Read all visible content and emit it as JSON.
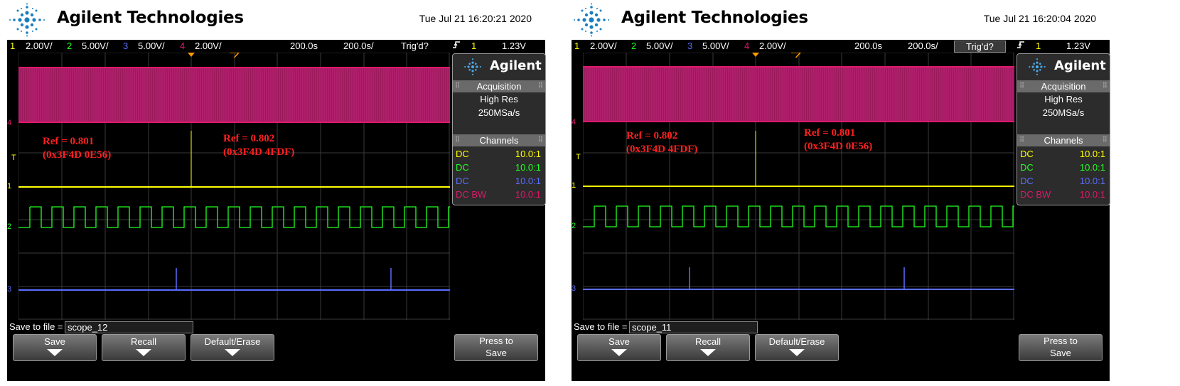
{
  "panels": [
    {
      "brand": "Agilent Technologies",
      "datetime": "Tue Jul 21 16:20:21 2020",
      "status": {
        "ch1_num": "1",
        "ch1_scale": "2.00V/",
        "ch2_num": "2",
        "ch2_scale": "5.00V/",
        "ch3_num": "3",
        "ch3_scale": "5.00V/",
        "ch4_num": "4",
        "ch4_scale": "2.00V/",
        "delay": "200.0s",
        "timebase": "200.0s/",
        "trig_state": "Trig'd?",
        "trig_slope_icon": "rising-edge-icon",
        "trig_source": "1",
        "trig_level": "1.23V"
      },
      "side": {
        "logo": "Agilent",
        "acq_title": "Acquisition",
        "acq_mode": "High Res",
        "acq_rate": "250MSa/s",
        "channels_title": "Channels",
        "channels": [
          {
            "coupling": "DC",
            "probe": "10.0:1",
            "color": "#ffff00"
          },
          {
            "coupling": "DC",
            "probe": "10.0:1",
            "color": "#22ff22"
          },
          {
            "coupling": "DC",
            "probe": "10.0:1",
            "color": "#5a6cff"
          },
          {
            "coupling": "DC BW",
            "probe": "10.0:1",
            "color": "#e0186c"
          }
        ]
      },
      "annotations": [
        {
          "line1": "Ref = 0.801",
          "line2": "(0x3F4D 0E56)"
        },
        {
          "line1": "Ref = 0.802",
          "line2": "(0x3F4D 4FDF)"
        }
      ],
      "save_label": "Save to file =",
      "save_file": "scope_12",
      "softkeys": [
        "Save",
        "Recall",
        "Default/Erase"
      ],
      "press_line1": "Press to",
      "press_line2": "Save",
      "ch_markers": {
        "t": "T",
        "c1": "1",
        "c2": "2",
        "c3": "3",
        "c4": "4"
      }
    },
    {
      "brand": "Agilent Technologies",
      "datetime": "Tue Jul 21 16:20:04 2020",
      "status": {
        "ch1_num": "1",
        "ch1_scale": "2.00V/",
        "ch2_num": "2",
        "ch2_scale": "5.00V/",
        "ch3_num": "3",
        "ch3_scale": "5.00V/",
        "ch4_num": "4",
        "ch4_scale": "2.00V/",
        "delay": "200.0s",
        "timebase": "200.0s/",
        "trig_state": "Trig'd?",
        "trig_slope_icon": "rising-edge-icon",
        "trig_source": "1",
        "trig_level": "1.23V"
      },
      "side": {
        "logo": "Agilent",
        "acq_title": "Acquisition",
        "acq_mode": "High Res",
        "acq_rate": "250MSa/s",
        "channels_title": "Channels",
        "channels": [
          {
            "coupling": "DC",
            "probe": "10.0:1",
            "color": "#ffff00"
          },
          {
            "coupling": "DC",
            "probe": "10.0:1",
            "color": "#22ff22"
          },
          {
            "coupling": "DC",
            "probe": "10.0:1",
            "color": "#5a6cff"
          },
          {
            "coupling": "DC BW",
            "probe": "10.0:1",
            "color": "#e0186c"
          }
        ]
      },
      "annotations": [
        {
          "line1": "Ref = 0.802",
          "line2": "(0x3F4D 4FDF)"
        },
        {
          "line1": "Ref = 0.801",
          "line2": "(0x3F4D 0E56)"
        }
      ],
      "save_label": "Save to file =",
      "save_file": "scope_11",
      "softkeys": [
        "Save",
        "Recall",
        "Default/Erase"
      ],
      "press_line1": "Press to",
      "press_line2": "Save",
      "ch_markers": {
        "t": "T",
        "c1": "1",
        "c2": "2",
        "c3": "3",
        "c4": "4"
      }
    }
  ],
  "colors": {
    "ch1": "#ffff00",
    "ch2": "#22ff22",
    "ch3": "#5a6cff",
    "ch4": "#e0186c",
    "annotation": "#ff2020",
    "agilent_spark": "#1a7fc0"
  }
}
